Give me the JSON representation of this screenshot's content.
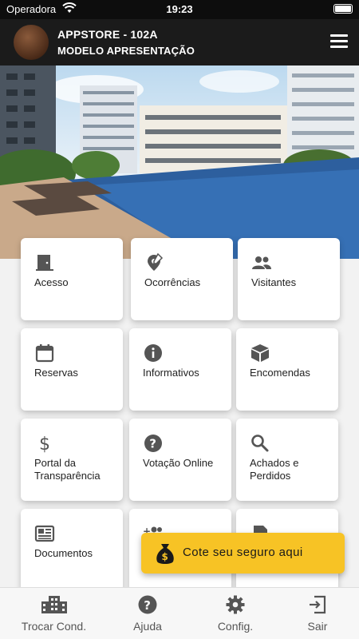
{
  "status_bar": {
    "carrier": "Operadora",
    "time": "19:23"
  },
  "header": {
    "title": "APPSTORE - 102A",
    "subtitle": "MODELO APRESENTAÇÃO"
  },
  "tiles": [
    {
      "label": "Acesso",
      "icon": "door-icon"
    },
    {
      "label": "Ocorrências",
      "icon": "location-edit-icon"
    },
    {
      "label": "Visitantes",
      "icon": "people-icon"
    },
    {
      "label": "Reservas",
      "icon": "calendar-icon"
    },
    {
      "label": "Informativos",
      "icon": "info-icon"
    },
    {
      "label": "Encomendas",
      "icon": "package-icon"
    },
    {
      "label": "Portal da Transparência",
      "icon": "dollar-icon"
    },
    {
      "label": "Votação Online",
      "icon": "help-icon"
    },
    {
      "label": "Achados e Perdidos",
      "icon": "search-icon"
    },
    {
      "label": "Documentos",
      "icon": "newspaper-icon"
    },
    {
      "label": "",
      "icon": "add-group-icon"
    },
    {
      "label": "",
      "icon": "document-icon"
    }
  ],
  "insurance_button": {
    "label": "Cote seu seguro aqui",
    "icon": "money-bag-icon"
  },
  "bottom_nav": [
    {
      "label": "Trocar Cond.",
      "icon": "building-icon"
    },
    {
      "label": "Ajuda",
      "icon": "help-icon"
    },
    {
      "label": "Config.",
      "icon": "gear-icon"
    },
    {
      "label": "Sair",
      "icon": "exit-icon"
    }
  ],
  "colors": {
    "header_bg": "#1b1b1b",
    "accent_yellow": "#f7c325",
    "icon_gray": "#555555"
  }
}
